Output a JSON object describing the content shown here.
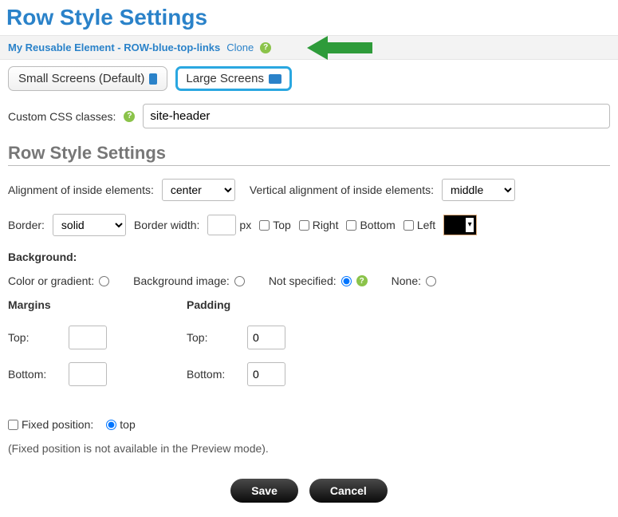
{
  "page_title": "Row Style Settings",
  "breadcrumb": {
    "title": "My Reusable Element - ROW-blue-top-links",
    "clone": "Clone"
  },
  "tabs": {
    "small": "Small Screens (Default)",
    "large": "Large Screens"
  },
  "css": {
    "label": "Custom CSS classes:",
    "value": "site-header"
  },
  "section_title": "Row Style Settings",
  "align": {
    "label": "Alignment of inside elements:",
    "value": "center",
    "vlabel": "Vertical alignment of inside elements:",
    "vvalue": "middle"
  },
  "border": {
    "label": "Border:",
    "style": "solid",
    "width_label": "Border width:",
    "width_value": "",
    "unit": "px",
    "top": "Top",
    "right": "Right",
    "bottom": "Bottom",
    "left": "Left",
    "color": "#000000"
  },
  "background": {
    "heading": "Background:",
    "color_gradient": "Color or gradient:",
    "image": "Background image:",
    "not_specified": "Not specified:",
    "none": "None:"
  },
  "margins": {
    "heading": "Margins",
    "top_label": "Top:",
    "top_value": "",
    "bottom_label": "Bottom:",
    "bottom_value": ""
  },
  "padding": {
    "heading": "Padding",
    "top_label": "Top:",
    "top_value": "0",
    "bottom_label": "Bottom:",
    "bottom_value": "0"
  },
  "fixed": {
    "label": "Fixed position:",
    "top": "top",
    "note": "(Fixed position is not available in the Preview mode)."
  },
  "buttons": {
    "save": "Save",
    "cancel": "Cancel"
  }
}
